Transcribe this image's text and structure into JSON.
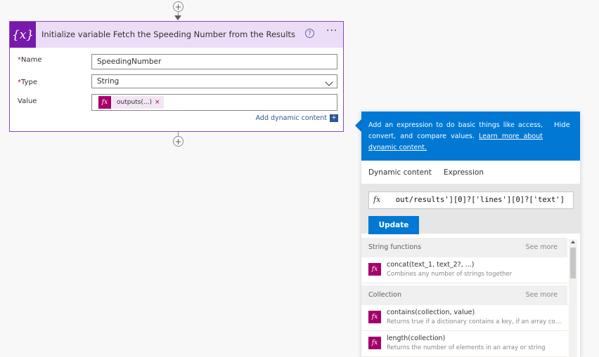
{
  "card": {
    "icon_text": "{x}",
    "title": "Initialize variable Fetch the Speeding Number from the Results",
    "help_icon": "?",
    "more_icon": "···",
    "fields": {
      "name_label": "Name",
      "name_value": "SpeedingNumber",
      "type_label": "Type",
      "type_value": "String",
      "value_label": "Value",
      "required_mark": "*"
    },
    "token": {
      "icon_text": "fx",
      "label": "outputs(...)",
      "remove": "×"
    },
    "add_dynamic_label": "Add dynamic content",
    "add_dynamic_icon": "+"
  },
  "flow": {
    "plus": "+"
  },
  "expression_panel": {
    "description": "Add an expression to do basic things like access, convert, and compare values.",
    "learn_more": "Learn more about dynamic content.",
    "hide_label": "Hide",
    "tabs": [
      "Dynamic content",
      "Expression"
    ],
    "active_tab": "Expression",
    "expression_fx": "fx",
    "expression_text": "out/results'][0]?['lines'][0]?['text']",
    "update_label": "Update",
    "sections": [
      {
        "title": "String functions",
        "see_more": "See more",
        "functions": [
          {
            "name": "concat(text_1, text_2?, ...)",
            "desc": "Combines any number of strings together"
          }
        ]
      },
      {
        "title": "Collection",
        "see_more": "See more",
        "functions": [
          {
            "name": "contains(collection, value)",
            "desc": "Returns true if a dictionary contains a key, if an array con..."
          },
          {
            "name": "length(collection)",
            "desc": "Returns the number of elements in an array or string"
          }
        ]
      }
    ]
  },
  "colors": {
    "accent": "#0078d4",
    "variable_purple": "#7719aa",
    "function_magenta": "#a4006b",
    "header_lavender": "#ebddf7"
  }
}
